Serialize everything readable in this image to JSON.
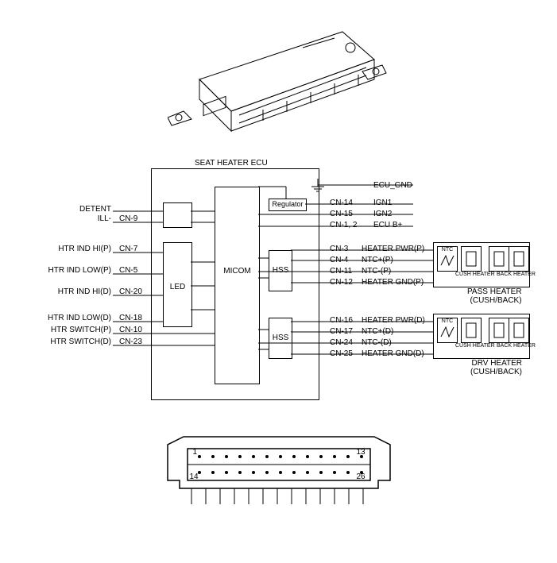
{
  "title": "SEAT HEATER ECU",
  "blocks": {
    "regulator": "Regulator",
    "micom": "MICOM",
    "led": "LED",
    "hss1": "HSS",
    "hss2": "HSS"
  },
  "left_signals": [
    {
      "label": "DETENT",
      "pin": ""
    },
    {
      "label": "ILL-",
      "pin": "CN-9"
    },
    {
      "label": "HTR IND HI(P)",
      "pin": "CN-7"
    },
    {
      "label": "HTR IND LOW(P)",
      "pin": "CN-5"
    },
    {
      "label": "HTR IND HI(D)",
      "pin": "CN-20"
    },
    {
      "label": "HTR IND LOW(D)",
      "pin": "CN-18"
    },
    {
      "label": "HTR SWITCH(P)",
      "pin": "CN-10"
    },
    {
      "label": "HTR SWITCH(D)",
      "pin": "CN-23"
    }
  ],
  "right_signals": [
    {
      "pin": "",
      "label": "ECU_GND"
    },
    {
      "pin": "CN-14",
      "label": "IGN1"
    },
    {
      "pin": "CN-15",
      "label": "IGN2"
    },
    {
      "pin": "CN-1, 2",
      "label": "ECU B+"
    },
    {
      "pin": "CN-3",
      "label": "HEATER PWR(P)"
    },
    {
      "pin": "CN-4",
      "label": "NTC+(P)"
    },
    {
      "pin": "CN-11",
      "label": "NTC-(P)"
    },
    {
      "pin": "CN-12",
      "label": "HEATER GND(P)"
    },
    {
      "pin": "CN-16",
      "label": "HEATER PWR(D)"
    },
    {
      "pin": "CN-17",
      "label": "NTC+(D)"
    },
    {
      "pin": "CN-24",
      "label": "NTC-(D)"
    },
    {
      "pin": "CN-25",
      "label": "HEATER GND(D)"
    }
  ],
  "heater_blocks": {
    "ntc": "NTC",
    "cush": "CUSH HEATER",
    "back": "BACK HEATER",
    "pass": "PASS HEATER\n(CUSH/BACK)",
    "drv": "DRV HEATER\n(CUSH/BACK)"
  },
  "connector_pins": {
    "p1": "1",
    "p13": "13",
    "p14": "14",
    "p26": "26"
  }
}
